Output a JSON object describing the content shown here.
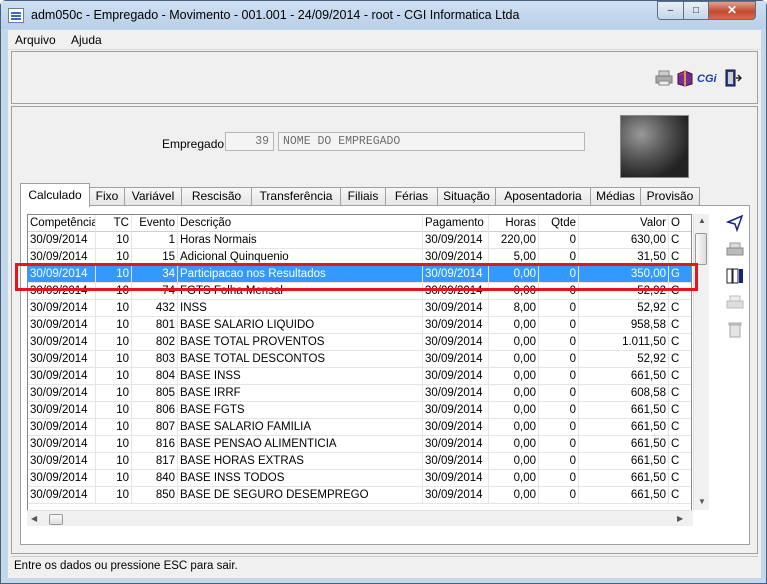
{
  "window": {
    "title": "adm050c - Empregado - Movimento - 001.001 - 24/09/2014 - root - CGI Informatica Ltda",
    "min_glyph": "–",
    "max_glyph": "□",
    "close_glyph": "✕"
  },
  "menu": [
    "Arquivo",
    "Ajuda"
  ],
  "toolbar": {
    "icons": [
      "printer-icon",
      "book-icon",
      "cgi-logo-icon",
      "exit-door-icon"
    ],
    "cgi_text": "CGi"
  },
  "employee": {
    "label": "Empregado:",
    "id": "39",
    "name": "NOME DO EMPREGADO"
  },
  "tabs": [
    "Calculado",
    "Fixo",
    "Variável",
    "Rescisão",
    "Transferência",
    "Filiais",
    "Férias",
    "Situação",
    "Aposentadoria",
    "Médias",
    "Provisão"
  ],
  "active_tab": "Calculado",
  "grid": {
    "columns": [
      "Competência",
      "TC",
      "Evento",
      "Descrição",
      "Pagamento",
      "Horas",
      "Qtde",
      "Valor",
      "O"
    ],
    "rows": [
      [
        "30/09/2014",
        "10",
        "1",
        "Horas Normais",
        "30/09/2014",
        "220,00",
        "0",
        "630,00",
        "C"
      ],
      [
        "30/09/2014",
        "10",
        "15",
        "Adicional Quinquenio",
        "30/09/2014",
        "5,00",
        "0",
        "31,50",
        "C"
      ],
      [
        "30/09/2014",
        "10",
        "34",
        "Participacao nos Resultados",
        "30/09/2014",
        "0,00",
        "0",
        "350,00",
        "G"
      ],
      [
        "30/09/2014",
        "10",
        "74",
        "FGTS Folha Mensal",
        "30/09/2014",
        "0,00",
        "0",
        "52,92",
        "C"
      ],
      [
        "30/09/2014",
        "10",
        "432",
        "INSS",
        "30/09/2014",
        "8,00",
        "0",
        "52,92",
        "C"
      ],
      [
        "30/09/2014",
        "10",
        "801",
        "BASE SALARIO LIQUIDO",
        "30/09/2014",
        "0,00",
        "0",
        "958,58",
        "C"
      ],
      [
        "30/09/2014",
        "10",
        "802",
        "BASE TOTAL PROVENTOS",
        "30/09/2014",
        "0,00",
        "0",
        "1.011,50",
        "C"
      ],
      [
        "30/09/2014",
        "10",
        "803",
        "BASE TOTAL DESCONTOS",
        "30/09/2014",
        "0,00",
        "0",
        "52,92",
        "C"
      ],
      [
        "30/09/2014",
        "10",
        "804",
        "BASE INSS",
        "30/09/2014",
        "0,00",
        "0",
        "661,50",
        "C"
      ],
      [
        "30/09/2014",
        "10",
        "805",
        "BASE IRRF",
        "30/09/2014",
        "0,00",
        "0",
        "608,58",
        "C"
      ],
      [
        "30/09/2014",
        "10",
        "806",
        "BASE FGTS",
        "30/09/2014",
        "0,00",
        "0",
        "661,50",
        "C"
      ],
      [
        "30/09/2014",
        "10",
        "807",
        "BASE SALARIO FAMILIA",
        "30/09/2014",
        "0,00",
        "0",
        "661,50",
        "C"
      ],
      [
        "30/09/2014",
        "10",
        "816",
        "BASE PENSAO ALIMENTICIA",
        "30/09/2014",
        "0,00",
        "0",
        "661,50",
        "C"
      ],
      [
        "30/09/2014",
        "10",
        "817",
        "BASE HORAS EXTRAS",
        "30/09/2014",
        "0,00",
        "0",
        "661,50",
        "C"
      ],
      [
        "30/09/2014",
        "10",
        "840",
        "BASE INSS TODOS",
        "30/09/2014",
        "0,00",
        "0",
        "661,50",
        "C"
      ],
      [
        "30/09/2014",
        "10",
        "850",
        "BASE DE SEGURO DESEMPREGO",
        "30/09/2014",
        "0,00",
        "0",
        "661,50",
        "C"
      ]
    ],
    "selected_row": 2
  },
  "side_icons": [
    "filter-arrow-icon",
    "printer-grey-icon",
    "columns-settings-icon",
    "print-disabled-icon",
    "trash-icon"
  ],
  "status": "Entre os dados ou pressione ESC para sair.",
  "colors": {
    "selection": "#3399ff",
    "highlight_border": "#e8141c"
  }
}
